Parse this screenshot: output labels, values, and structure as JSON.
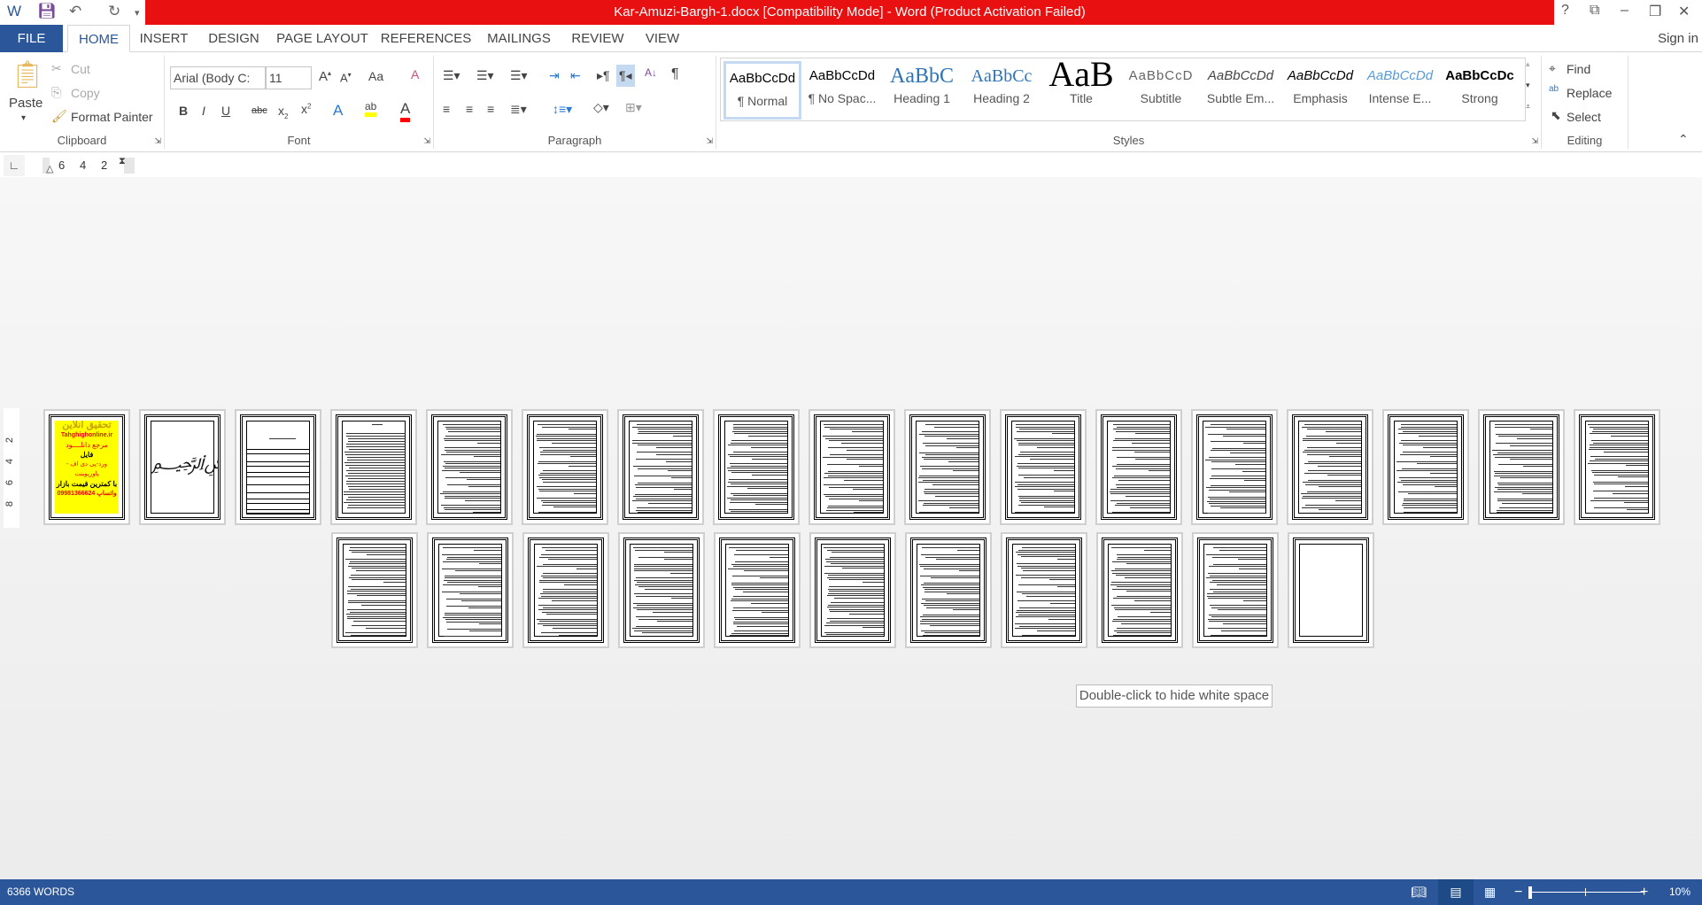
{
  "title": "Kar-Amuzi-Bargh-1.docx [Compatibility Mode] -  Word (Product Activation Failed)",
  "window": {
    "help": "?",
    "restore_ribbon": "⧉",
    "minimize": "–",
    "maximize": "❐",
    "close": "✕"
  },
  "tabs": [
    {
      "label": "FILE"
    },
    {
      "label": "HOME"
    },
    {
      "label": "INSERT"
    },
    {
      "label": "DESIGN"
    },
    {
      "label": "PAGE LAYOUT"
    },
    {
      "label": "REFERENCES"
    },
    {
      "label": "MAILINGS"
    },
    {
      "label": "REVIEW"
    },
    {
      "label": "VIEW"
    }
  ],
  "sign_in": "Sign in",
  "clipboard": {
    "label": "Clipboard",
    "paste": "Paste",
    "cut": "Cut",
    "copy": "Copy",
    "format_painter": "Format Painter"
  },
  "font": {
    "label": "Font",
    "name": "Arial (Body C:",
    "size": "11",
    "change_case": "Aa",
    "highlight_color": "#ffff00",
    "font_color": "#ff0000"
  },
  "paragraph": {
    "label": "Paragraph"
  },
  "styles": {
    "label": "Styles",
    "items": [
      {
        "preview": "AaBbCcDd",
        "name": "¶ Normal"
      },
      {
        "preview": "AaBbCcDd",
        "name": "¶ No Spac..."
      },
      {
        "preview": "AaBbC",
        "name": "Heading 1"
      },
      {
        "preview": "AaBbCc",
        "name": "Heading 2"
      },
      {
        "preview": "AaB",
        "name": "Title"
      },
      {
        "preview": "AaBbCcD",
        "name": "Subtitle"
      },
      {
        "preview": "AaBbCcDd",
        "name": "Subtle Em..."
      },
      {
        "preview": "AaBbCcDd",
        "name": "Emphasis"
      },
      {
        "preview": "AaBbCcDd",
        "name": "Intense E..."
      },
      {
        "preview": "AaBbCcDc",
        "name": "Strong"
      }
    ]
  },
  "editing": {
    "label": "Editing",
    "find": "Find",
    "replace": "Replace",
    "select": "Select"
  },
  "ruler": {
    "h_ticks": [
      "6",
      "4",
      "2"
    ],
    "v_ticks": [
      "2",
      "4",
      "6",
      "8"
    ]
  },
  "cover": {
    "l1": "تحقیق آنلاین",
    "l2": "Tahghighonline.ir",
    "l3": "مرجع دانلــــود",
    "l4": "فایل",
    "l5": "ورد-پی دی اف - پاورپوینت",
    "l6": "با کمترین قیمت بازار",
    "l7": "09981366624 واتساپ"
  },
  "pages": [
    "cover",
    "bismillah",
    "boxes",
    "toc",
    "text",
    "text",
    "text",
    "text",
    "text",
    "text",
    "text",
    "text",
    "text",
    "text",
    "text",
    "text",
    "text",
    "text",
    "text",
    "text",
    "text",
    "text",
    "text",
    "text",
    "text",
    "text",
    "text",
    "blank"
  ],
  "tooltip": "Double-click to hide white space",
  "status": {
    "words": "6366 WORDS",
    "zoom": "10%",
    "zoom_level_percent": 10
  },
  "colors": {
    "title_bar": "#e81010",
    "accent": "#2b579a"
  }
}
